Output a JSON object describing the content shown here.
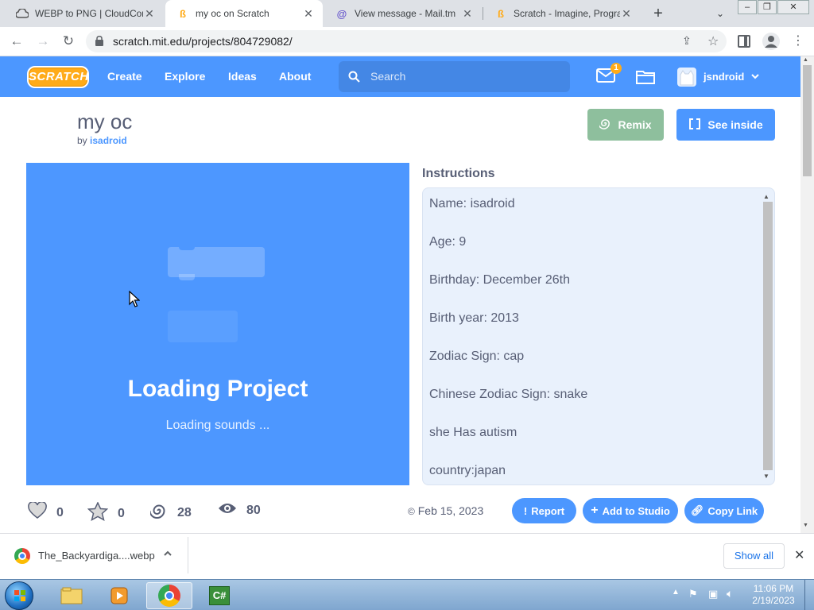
{
  "browser": {
    "tabs": [
      {
        "title": "WEBP to PNG | CloudCon",
        "icon": "cloudconvert-icon"
      },
      {
        "title": "my oc on Scratch",
        "icon": "scratch-icon"
      },
      {
        "title": "View message - Mail.tm",
        "icon": "at-icon"
      },
      {
        "title": "Scratch - Imagine, Progra",
        "icon": "scratch-icon"
      }
    ],
    "url": "scratch.mit.edu/projects/804729082/"
  },
  "scratch_nav": {
    "logo": "SCRATCH",
    "links": [
      "Create",
      "Explore",
      "Ideas",
      "About"
    ],
    "search_placeholder": "Search",
    "notification_count": "1",
    "username": "jsndroid"
  },
  "project": {
    "title": "my oc",
    "by_label": "by",
    "author": "isadroid",
    "remix_label": "Remix",
    "see_inside_label": "See inside",
    "loading_title": "Loading Project",
    "loading_status": "Loading sounds ...",
    "instructions_heading": "Instructions",
    "instructions": [
      "Name: isadroid",
      "Age: 9",
      "Birthday: December 26th",
      "Birth year: 2013",
      "Zodiac Sign: cap",
      "Chinese Zodiac Sign: snake",
      "she Has autism",
      "country:japan"
    ],
    "stats": {
      "loves": "0",
      "favorites": "0",
      "remixes": "28",
      "views": "80"
    },
    "date": "Feb 15, 2023",
    "report_label": "Report",
    "add_studio_label": "Add to Studio",
    "copy_link_label": "Copy Link"
  },
  "download_bar": {
    "filename": "The_Backyardiga....webp",
    "show_all_label": "Show all"
  },
  "taskbar": {
    "time": "11:06 PM",
    "date": "2/19/2023"
  },
  "colors": {
    "scratch_blue": "#4c97ff",
    "remix_green": "#8ebf9d",
    "text_gray": "#575e75"
  }
}
